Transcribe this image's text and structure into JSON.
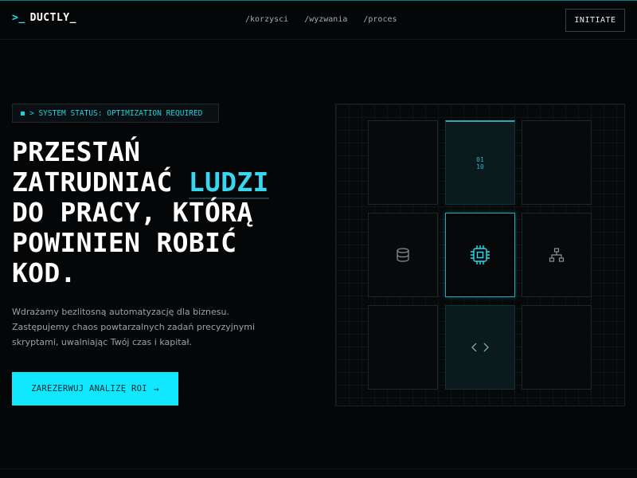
{
  "brand": {
    "prompt": ">_",
    "name": "DUCTLY_"
  },
  "nav": {
    "links": [
      "/korzysci",
      "/wyzwania",
      "/proces"
    ],
    "initiate_label": "INITIATE"
  },
  "hero": {
    "status": "> SYSTEM STATUS: OPTIMIZATION REQUIRED",
    "headline": {
      "line1": "PRZESTAŃ",
      "line2_pre": "ZATRUDNIAĆ ",
      "line2_accent": "LUDZI",
      "line3": "DO PRACY, KTÓRĄ",
      "line4": "POWINIEN ROBIĆ",
      "line5": "KOD."
    },
    "subtext": [
      "Wdrażamy bezlitosną automatyzację dla biznesu.",
      "Zastępujemy chaos powtarzalnych zadań precyzyjnymi",
      "skryptami, uwalniając Twój czas i kapitał."
    ],
    "cta_label": "ZAREZERWUJ ANALIZĘ ROI",
    "cta_arrow": "→"
  },
  "grid": {
    "binary": [
      "01",
      "10"
    ],
    "icons": [
      "database-icon",
      "chip-icon",
      "network-icon",
      "code-icon"
    ]
  },
  "colors": {
    "accent": "#10e8ff",
    "accent_text": "#38d6f0",
    "background": "#050607"
  }
}
